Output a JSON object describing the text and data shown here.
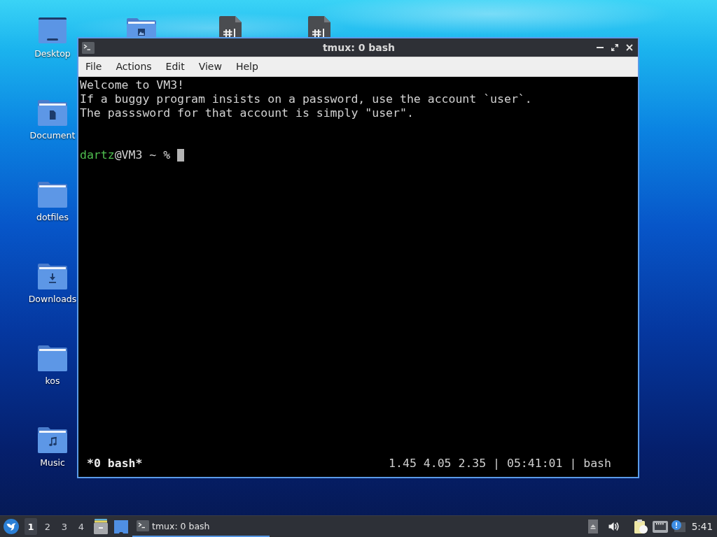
{
  "desktop_icons": {
    "top_row": [
      {
        "kind": "desktop",
        "label": "Desktop"
      },
      {
        "kind": "pictures"
      },
      {
        "kind": "script"
      },
      {
        "kind": "script"
      }
    ],
    "left_column": [
      {
        "kind": "documents",
        "label": "Document"
      },
      {
        "kind": "folder",
        "label": "dotfiles"
      },
      {
        "kind": "downloads",
        "label": "Downloads"
      },
      {
        "kind": "folder",
        "label": "kos"
      },
      {
        "kind": "music",
        "label": "Music"
      }
    ]
  },
  "window": {
    "title": "tmux: 0 bash",
    "menu": [
      "File",
      "Actions",
      "Edit",
      "View",
      "Help"
    ],
    "terminal": {
      "lines": [
        "Welcome to VM3!",
        "If a buggy program insists on a password, use the account `user`.",
        "The passsword for that account is simply \"user\"."
      ],
      "prompt": {
        "user": "dartz",
        "host": "@VM3 ~ %"
      },
      "status": {
        "left": "*0 bash*",
        "right": "1.45 4.05 2.35 | 05:41:01 | bash"
      }
    }
  },
  "taskbar": {
    "workspaces": [
      {
        "label": "1",
        "selected": true
      },
      {
        "label": "2",
        "selected": false
      },
      {
        "label": "3",
        "selected": false
      },
      {
        "label": "4",
        "selected": false
      }
    ],
    "tasks": [
      {
        "label": "tmux: 0 bash",
        "selected": true
      }
    ],
    "clock": "5:41"
  }
}
